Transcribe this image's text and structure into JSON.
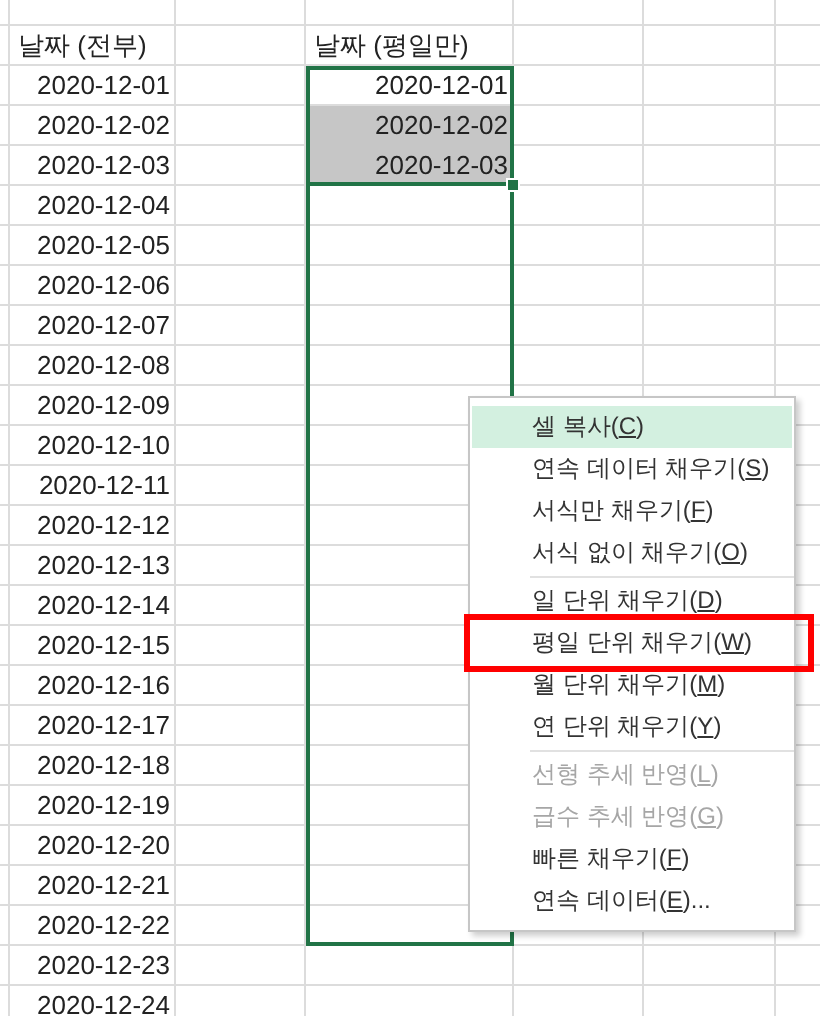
{
  "sheet": {
    "headers": {
      "all": "날짜 (전부)",
      "weekday": "날짜 (평일만)"
    },
    "rows": [
      {
        "date_all": "2020-12-01",
        "date_weekday": "2020-12-01",
        "selected": false,
        "fill_handle": false,
        "in_fill_range": true
      },
      {
        "date_all": "2020-12-02",
        "date_weekday": "2020-12-02",
        "selected": true,
        "fill_handle": false,
        "in_fill_range": true
      },
      {
        "date_all": "2020-12-03",
        "date_weekday": "2020-12-03",
        "selected": true,
        "fill_handle": true,
        "in_fill_range": true
      },
      {
        "date_all": "2020-12-04",
        "selected": false,
        "fill_handle": false,
        "in_fill_range": true
      },
      {
        "date_all": "2020-12-05",
        "selected": false,
        "fill_handle": false,
        "in_fill_range": true
      },
      {
        "date_all": "2020-12-06",
        "selected": false,
        "fill_handle": false,
        "in_fill_range": true
      },
      {
        "date_all": "2020-12-07",
        "selected": false,
        "fill_handle": false,
        "in_fill_range": true
      },
      {
        "date_all": "2020-12-08",
        "selected": false,
        "fill_handle": false,
        "in_fill_range": true
      },
      {
        "date_all": "2020-12-09",
        "selected": false,
        "fill_handle": false,
        "in_fill_range": true
      },
      {
        "date_all": "2020-12-10",
        "selected": false,
        "fill_handle": false,
        "in_fill_range": true
      },
      {
        "date_all": "2020-12-11",
        "selected": false,
        "fill_handle": false,
        "in_fill_range": true
      },
      {
        "date_all": "2020-12-12",
        "selected": false,
        "fill_handle": false,
        "in_fill_range": true
      },
      {
        "date_all": "2020-12-13",
        "selected": false,
        "fill_handle": false,
        "in_fill_range": true
      },
      {
        "date_all": "2020-12-14",
        "selected": false,
        "fill_handle": false,
        "in_fill_range": true
      },
      {
        "date_all": "2020-12-15",
        "selected": false,
        "fill_handle": false,
        "in_fill_range": true
      },
      {
        "date_all": "2020-12-16",
        "selected": false,
        "fill_handle": false,
        "in_fill_range": true
      },
      {
        "date_all": "2020-12-17",
        "selected": false,
        "fill_handle": false,
        "in_fill_range": true
      },
      {
        "date_all": "2020-12-18",
        "selected": false,
        "fill_handle": false,
        "in_fill_range": true
      },
      {
        "date_all": "2020-12-19",
        "selected": false,
        "fill_handle": false,
        "in_fill_range": true
      },
      {
        "date_all": "2020-12-20",
        "selected": false,
        "fill_handle": false,
        "in_fill_range": true
      },
      {
        "date_all": "2020-12-21",
        "selected": false,
        "fill_handle": false,
        "in_fill_range": true
      },
      {
        "date_all": "2020-12-22",
        "selected": false,
        "fill_handle": false,
        "in_fill_range": true
      },
      {
        "date_all": "2020-12-23",
        "selected": false,
        "fill_handle": false,
        "in_fill_range": false
      },
      {
        "date_all": "2020-12-24",
        "selected": false,
        "fill_handle": false,
        "in_fill_range": false
      }
    ]
  },
  "menu": {
    "items": [
      {
        "kind": "item",
        "label": "셀 복사",
        "key": "(C)",
        "selected": true,
        "disabled": false,
        "annotated": false
      },
      {
        "kind": "item",
        "label": "연속 데이터 채우기",
        "key": "(S)",
        "selected": false,
        "disabled": false,
        "annotated": false
      },
      {
        "kind": "item",
        "label": "서식만 채우기",
        "key": "(F)",
        "selected": false,
        "disabled": false,
        "annotated": false
      },
      {
        "kind": "item",
        "label": "서식 없이 채우기",
        "key": "(O)",
        "selected": false,
        "disabled": false,
        "annotated": false
      },
      {
        "kind": "separator"
      },
      {
        "kind": "item",
        "label": "일 단위 채우기",
        "key": "(D)",
        "selected": false,
        "disabled": false,
        "annotated": false
      },
      {
        "kind": "item",
        "label": "평일 단위 채우기",
        "key": "(W)",
        "selected": false,
        "disabled": false,
        "annotated": true
      },
      {
        "kind": "item",
        "label": "월 단위 채우기",
        "key": "(M)",
        "selected": false,
        "disabled": false,
        "annotated": false
      },
      {
        "kind": "item",
        "label": "연 단위 채우기",
        "key": "(Y)",
        "selected": false,
        "disabled": false,
        "annotated": false
      },
      {
        "kind": "separator"
      },
      {
        "kind": "item",
        "label": "선형 추세 반영",
        "key": "(L)",
        "selected": false,
        "disabled": true,
        "annotated": false
      },
      {
        "kind": "item",
        "label": "급수 추세 반영",
        "key": "(G)",
        "selected": false,
        "disabled": true,
        "annotated": false
      },
      {
        "kind": "item",
        "label": "빠른 채우기",
        "key": "(F)",
        "selected": false,
        "disabled": false,
        "annotated": false
      },
      {
        "kind": "item",
        "label": "연속 데이터",
        "key": "(E)",
        "suffix": "...",
        "selected": false,
        "disabled": false,
        "annotated": false
      }
    ]
  }
}
